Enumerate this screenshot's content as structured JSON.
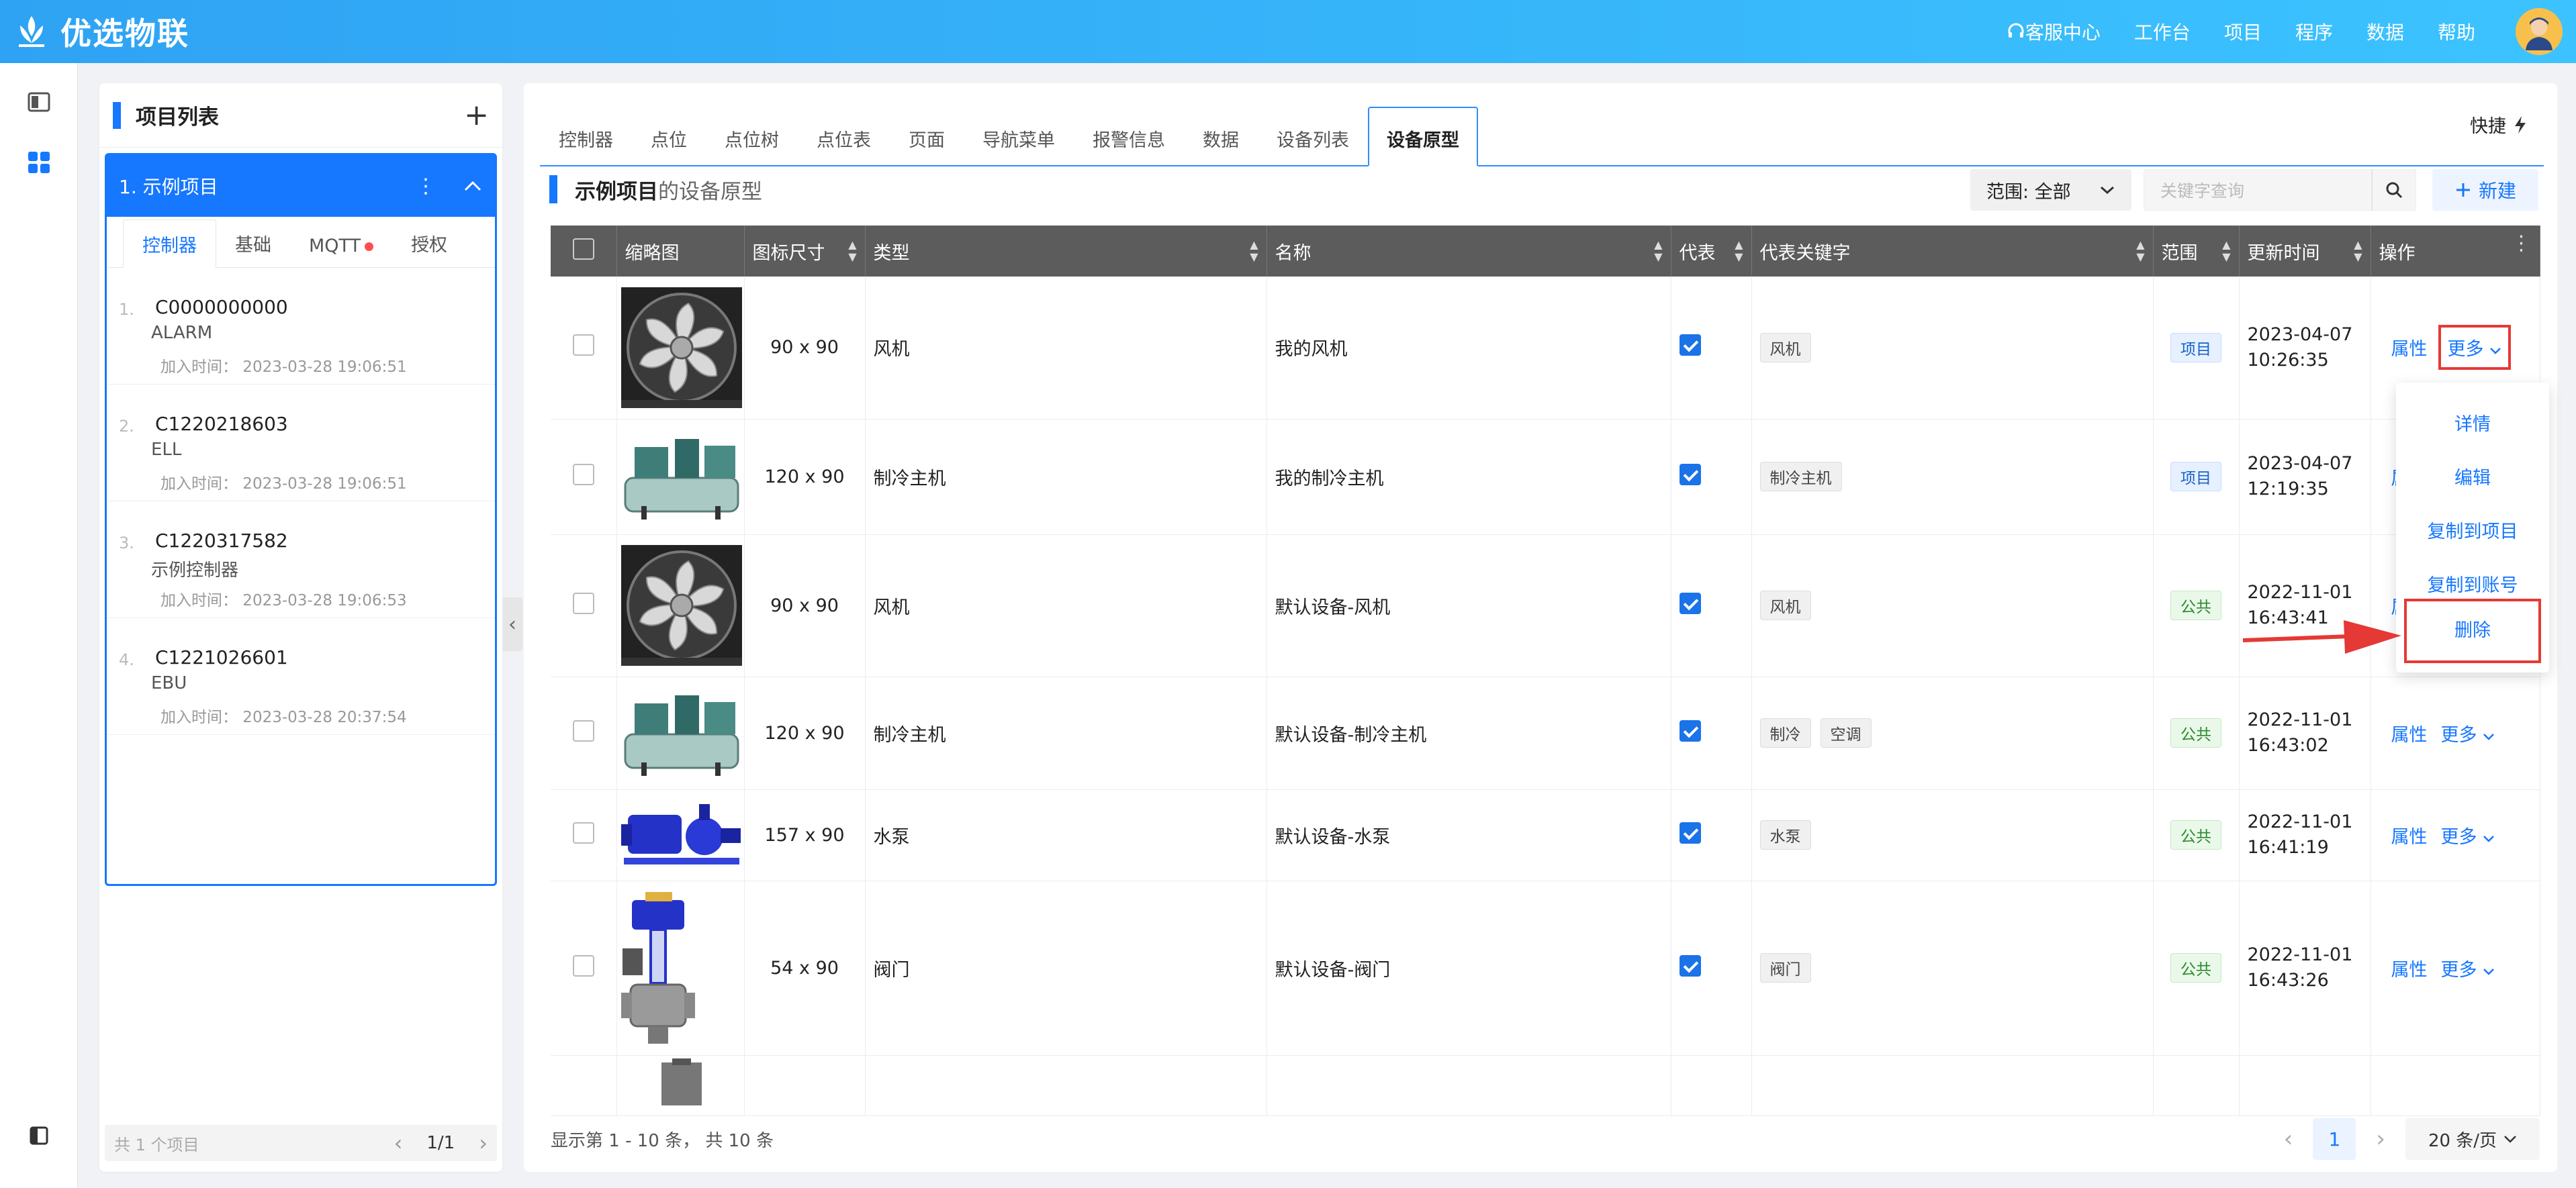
{
  "app": {
    "title": "优选物联"
  },
  "topnav": {
    "support": "客服中心",
    "workbench": "工作台",
    "project": "项目",
    "program": "程序",
    "data": "数据",
    "help": "帮助"
  },
  "left_panel": {
    "title": "项目列表",
    "project": {
      "name": "1. 示例项目"
    },
    "tabs": [
      {
        "label": "控制器"
      },
      {
        "label": "基础"
      },
      {
        "label": "MQTT"
      },
      {
        "label": "授权"
      }
    ],
    "controllers": [
      {
        "index": "1.",
        "code": "C0000000000",
        "name": "ALARM",
        "time": "加入时间： 2023-03-28 19:06:51"
      },
      {
        "index": "2.",
        "code": "C1220218603",
        "name": "ELL",
        "time": "加入时间： 2023-03-28 19:06:51"
      },
      {
        "index": "3.",
        "code": "C1220317582",
        "name": "示例控制器",
        "time": "加入时间： 2023-03-28 19:06:53"
      },
      {
        "index": "4.",
        "code": "C1221026601",
        "name": "EBU",
        "time": "加入时间： 2023-03-28 20:37:54"
      }
    ],
    "footer": {
      "total": "共 1 个项目",
      "page": "1/1"
    }
  },
  "main": {
    "tabs": [
      {
        "label": "控制器"
      },
      {
        "label": "点位"
      },
      {
        "label": "点位树"
      },
      {
        "label": "点位表"
      },
      {
        "label": "页面"
      },
      {
        "label": "导航菜单"
      },
      {
        "label": "报警信息"
      },
      {
        "label": "数据"
      },
      {
        "label": "设备列表"
      },
      {
        "label": "设备原型"
      }
    ],
    "quick": "快捷",
    "heading_project": "示例项目",
    "heading_rest": "的设备原型",
    "scope_label": "范围: 全部",
    "search_placeholder": "关键字查询",
    "new_label": "新建",
    "columns": [
      "缩略图",
      "图标尺寸",
      "类型",
      "名称",
      "代表",
      "代表关键字",
      "范围",
      "更新时间",
      "操作"
    ],
    "rows": [
      {
        "size": "90 x 90",
        "type": "风机",
        "name": "我的风机",
        "tags": [
          "风机"
        ],
        "scope": "项目",
        "date": "2023-04-07",
        "time": "10:26:35",
        "thumb": "fan-thumbnail"
      },
      {
        "size": "120 x 90",
        "type": "制冷主机",
        "name": "我的制冷主机",
        "tags": [
          "制冷主机"
        ],
        "scope": "项目",
        "date": "2023-04-07",
        "time": "12:19:35",
        "thumb": "chiller-thumbnail"
      },
      {
        "size": "90 x 90",
        "type": "风机",
        "name": "默认设备-风机",
        "tags": [
          "风机"
        ],
        "scope": "公共",
        "date": "2022-11-01",
        "time": "16:43:41",
        "thumb": "fan-thumbnail"
      },
      {
        "size": "120 x 90",
        "type": "制冷主机",
        "name": "默认设备-制冷主机",
        "tags": [
          "制冷",
          "空调"
        ],
        "scope": "公共",
        "date": "2022-11-01",
        "time": "16:43:02",
        "thumb": "chiller-thumbnail"
      },
      {
        "size": "157 x 90",
        "type": "水泵",
        "name": "默认设备-水泵",
        "tags": [
          "水泵"
        ],
        "scope": "公共",
        "date": "2022-11-01",
        "time": "16:41:19",
        "thumb": "pump-thumbnail"
      },
      {
        "size": "54 x 90",
        "type": "阀门",
        "name": "默认设备-阀门",
        "tags": [
          "阀门"
        ],
        "scope": "公共",
        "date": "2022-11-01",
        "time": "16:43:26",
        "thumb": "valve-thumbnail"
      }
    ],
    "action_attr": "属性",
    "action_more": "更多",
    "dropdown": [
      "详情",
      "编辑",
      "复制到项目",
      "复制到账号",
      "删除"
    ],
    "footer_summary": "显示第 1 - 10 条， 共 10 条",
    "current_page": "1",
    "page_size": "20 条/页"
  },
  "colors": {
    "primary": "#1677ff",
    "header": "#2fa3f3",
    "highlight": "#e53935"
  }
}
